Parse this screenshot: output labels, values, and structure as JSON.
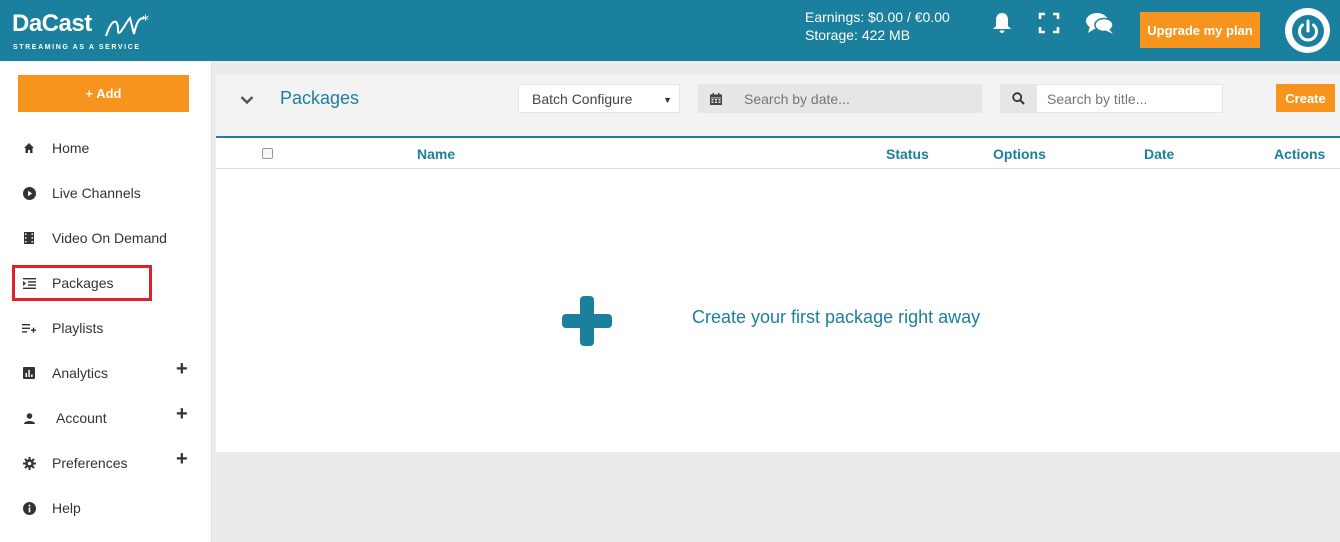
{
  "header": {
    "logo_text": "DaCast",
    "logo_tagline": "STREAMING AS A SERVICE",
    "earnings": "Earnings: $0.00 / €0.00",
    "storage": "Storage: 422 MB",
    "upgrade_label": "Upgrade my plan",
    "icons": [
      "bell-icon",
      "fullscreen-icon",
      "chat-icon",
      "power-icon"
    ]
  },
  "sidebar": {
    "add_label": "+ Add",
    "items": [
      {
        "label": "Home",
        "icon": "home-icon",
        "expandable": false
      },
      {
        "label": "Live Channels",
        "icon": "play-circle-icon",
        "expandable": false
      },
      {
        "label": "Video On Demand",
        "icon": "film-icon",
        "expandable": false
      },
      {
        "label": "Packages",
        "icon": "packages-icon",
        "expandable": false,
        "highlighted": true
      },
      {
        "label": "Playlists",
        "icon": "playlist-add-icon",
        "expandable": false
      },
      {
        "label": "Analytics",
        "icon": "bar-chart-icon",
        "expandable": true
      },
      {
        "label": "Account",
        "icon": "user-icon",
        "expandable": true
      },
      {
        "label": "Preferences",
        "icon": "gear-icon",
        "expandable": true
      },
      {
        "label": "Help",
        "icon": "info-icon",
        "expandable": false
      }
    ],
    "expand_symbol": "+"
  },
  "panel": {
    "title": "Packages",
    "batch_select": "Batch Configure",
    "date_placeholder": "Search by date...",
    "title_placeholder": "Search by title...",
    "create_label": "Create"
  },
  "table": {
    "columns": [
      "Name",
      "Status",
      "Options",
      "Date",
      "Actions"
    ]
  },
  "empty_state": {
    "message": "Create your first package right away"
  },
  "colors": {
    "brand": "#1b7f9e",
    "accent": "#f7941d",
    "highlight": "#e0202a"
  }
}
